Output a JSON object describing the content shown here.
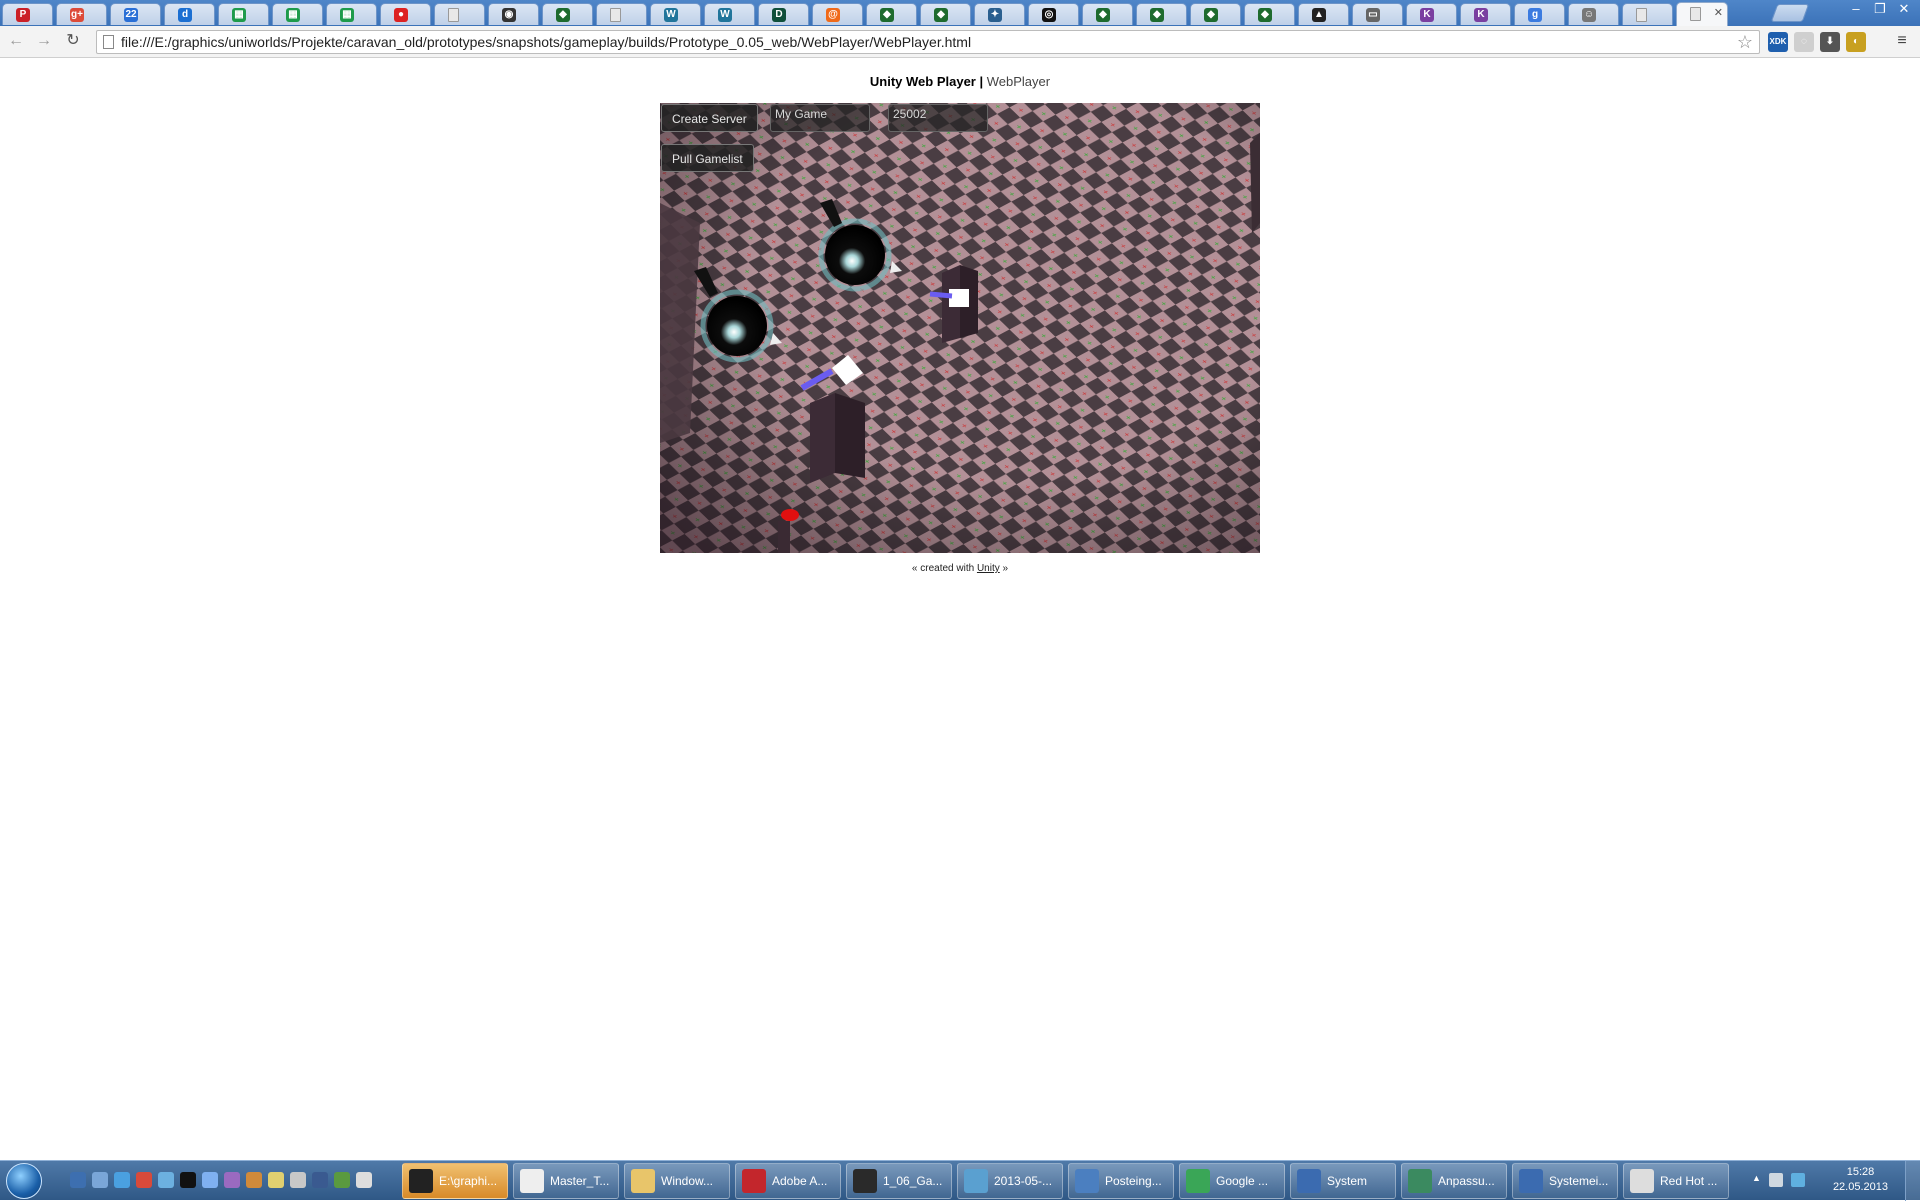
{
  "browser": {
    "tabs": [
      {
        "icon": "pinterest-icon",
        "color": "#cb2027",
        "glyph": "P"
      },
      {
        "icon": "google-plus-icon",
        "color": "#dd4b39",
        "glyph": "g+"
      },
      {
        "icon": "calendar-icon",
        "color": "#2a6fd6",
        "glyph": "22"
      },
      {
        "icon": "d-app-icon",
        "color": "#1b6fd2",
        "glyph": "d"
      },
      {
        "icon": "sheets-icon",
        "color": "#1e9b4b",
        "glyph": "▦"
      },
      {
        "icon": "sheets-icon",
        "color": "#1e9b4b",
        "glyph": "▦"
      },
      {
        "icon": "sheets-icon",
        "color": "#1e9b4b",
        "glyph": "▦"
      },
      {
        "icon": "record-icon",
        "color": "#d22",
        "glyph": "●"
      },
      {
        "icon": "page-icon",
        "color": "#e8e8e8",
        "glyph": ""
      },
      {
        "icon": "penguin-icon",
        "color": "#333",
        "glyph": "◉"
      },
      {
        "icon": "green-gem-icon",
        "color": "#1e6b2e",
        "glyph": "◆"
      },
      {
        "icon": "page-icon",
        "color": "#e8e8e8",
        "glyph": ""
      },
      {
        "icon": "wordpress-icon",
        "color": "#21759b",
        "glyph": "W"
      },
      {
        "icon": "wordpress-icon",
        "color": "#21759b",
        "glyph": "W"
      },
      {
        "icon": "d-dark-icon",
        "color": "#0f4f3a",
        "glyph": "D"
      },
      {
        "icon": "swirl-icon",
        "color": "#f06a1a",
        "glyph": "@"
      },
      {
        "icon": "green-gem-icon",
        "color": "#1e6b2e",
        "glyph": "◆"
      },
      {
        "icon": "green-gem-icon",
        "color": "#1e6b2e",
        "glyph": "◆"
      },
      {
        "icon": "feather-icon",
        "color": "#2a5f8f",
        "glyph": "✦"
      },
      {
        "icon": "eye-icon",
        "color": "#111",
        "glyph": "◎"
      },
      {
        "icon": "green-gem-icon",
        "color": "#1e6b2e",
        "glyph": "◆"
      },
      {
        "icon": "green-gem-icon",
        "color": "#1e6b2e",
        "glyph": "◆"
      },
      {
        "icon": "green-gem-icon",
        "color": "#1e6b2e",
        "glyph": "◆"
      },
      {
        "icon": "green-gem-icon",
        "color": "#1e6b2e",
        "glyph": "◆"
      },
      {
        "icon": "tux-icon",
        "color": "#222",
        "glyph": "▲"
      },
      {
        "icon": "image-icon",
        "color": "#666",
        "glyph": "▭"
      },
      {
        "icon": "k-icon",
        "color": "#7a3fa0",
        "glyph": "K"
      },
      {
        "icon": "k-icon",
        "color": "#7a3fa0",
        "glyph": "K"
      },
      {
        "icon": "google-icon",
        "color": "#3b7be0",
        "glyph": "g"
      },
      {
        "icon": "avatar-icon",
        "color": "#777",
        "glyph": "☺"
      },
      {
        "icon": "page-icon",
        "color": "#e8e8e8",
        "glyph": ""
      },
      {
        "icon": "page-icon",
        "color": "#e8e8e8",
        "glyph": ""
      }
    ],
    "active_tab_close": "✕",
    "window_controls": {
      "minimize": "–",
      "maximize": "❐",
      "close": "✕"
    },
    "nav": {
      "back": "←",
      "forward": "→",
      "reload": "↻"
    },
    "url": "file:///E:/graphics/uniworlds/Projekte/caravan_old/prototypes/snapshots/gameplay/builds/Prototype_0.05_web/WebPlayer/WebPlayer.html",
    "star": "☆",
    "extensions": [
      {
        "icon": "xdk-icon",
        "color": "#1f5fae",
        "glyph": "XDK"
      },
      {
        "icon": "circle-icon",
        "color": "#cfcfcf",
        "glyph": "◌"
      },
      {
        "icon": "download-icon",
        "color": "#555",
        "glyph": "⬇"
      },
      {
        "icon": "shield-icon",
        "color": "#c8a020",
        "glyph": "◐"
      }
    ],
    "menu": "≡"
  },
  "page": {
    "title_bold": "Unity Web Player |",
    "title_sub": "WebPlayer",
    "game": {
      "create_server_button": "Create Server",
      "game_name_field": "My Game",
      "port_field": "25002",
      "pull_gamelist_button": "Pull Gamelist"
    },
    "footer": {
      "prefix": "« created with",
      "link": "Unity",
      "suffix": "»"
    }
  },
  "taskbar": {
    "buttons": [
      {
        "label": "E:\\graphi...",
        "color": "#222",
        "active": true
      },
      {
        "label": "Master_T...",
        "color": "#eee",
        "active": false
      },
      {
        "label": "Window...",
        "color": "#e8c56a",
        "active": false
      },
      {
        "label": "Adobe A...",
        "color": "#c3262c",
        "active": false
      },
      {
        "label": "1_06_Ga...",
        "color": "#2a2a2a",
        "active": false
      },
      {
        "label": "2013-05-...",
        "color": "#5aa0d0",
        "active": false
      },
      {
        "label": "Posteing...",
        "color": "#4b7fc0",
        "active": false
      },
      {
        "label": "Google ...",
        "color": "#3aa657",
        "active": false
      },
      {
        "label": "System",
        "color": "#3b6bb0",
        "active": false
      },
      {
        "label": "Anpassu...",
        "color": "#3b8a60",
        "active": false
      },
      {
        "label": "Systemei...",
        "color": "#3b6bb0",
        "active": false
      },
      {
        "label": "Red Hot ...",
        "color": "#ddd",
        "active": false
      }
    ],
    "tray_arrow": "▲",
    "clock_time": "15:28",
    "clock_date": "22.05.2013"
  }
}
